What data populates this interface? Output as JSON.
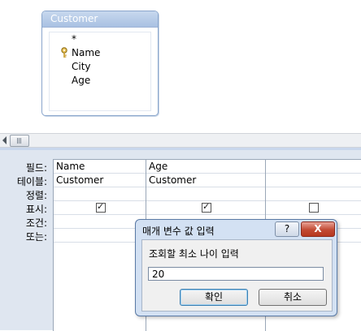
{
  "table_box": {
    "title": "Customer",
    "fields": [
      {
        "label": "*",
        "key": false
      },
      {
        "label": "Name",
        "key": true
      },
      {
        "label": "City",
        "key": false
      },
      {
        "label": "Age",
        "key": false
      }
    ]
  },
  "grid": {
    "row_labels": [
      "필드:",
      "테이블:",
      "정렬:",
      "표시:",
      "조건:",
      "또는:"
    ],
    "columns": [
      {
        "field": "Name",
        "table": "Customer",
        "show": true
      },
      {
        "field": "Age",
        "table": "Customer",
        "show": true
      },
      {
        "field": "",
        "table": "",
        "show": false
      }
    ]
  },
  "dialog": {
    "title": "매개 변수 값 입력",
    "help_label": "?",
    "close_label": "X",
    "prompt": "조회할 최소 나이 입력",
    "input_value": "20",
    "ok_label": "확인",
    "cancel_label": "취소"
  },
  "colors": {
    "grid_pane": "#dfe6f0",
    "dialog_frame": "#d3e1f3",
    "close_button": "#c24a33"
  }
}
